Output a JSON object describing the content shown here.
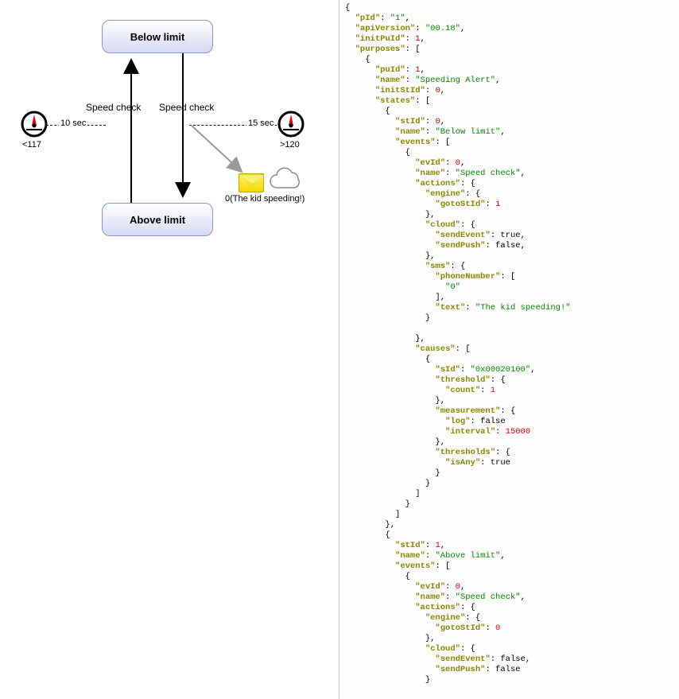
{
  "diagram": {
    "state_top": "Below limit",
    "state_bottom": "Above limit",
    "gauge_left_label": "<117",
    "gauge_right_label": ">120",
    "dash_left_label": "10 sec",
    "dash_right_label": "15 sec",
    "trans_left": "Speed check",
    "trans_right": "Speed check",
    "msg_caption": "0(The kid speeding!)"
  },
  "json_text": "{\n  \"pId\": \"1\",\n  \"apiVersion\": \"00.18\",\n  \"initPuId\": 1,\n  \"purposes\": [\n    {\n      \"puId\": 1,\n      \"name\": \"Speeding Alert\",\n      \"initStId\": 0,\n      \"states\": [\n        {\n          \"stId\": 0,\n          \"name\": \"Below limit\",\n          \"events\": [\n            {\n              \"evId\": 0,\n              \"name\": \"Speed check\",\n              \"actions\": {\n                \"engine\": {\n                  \"gotoStId\": 1\n                },\n                \"cloud\": {\n                  \"sendEvent\": true,\n                  \"sendPush\": false,\n                },\n                \"sms\": {\n                  \"phoneNumber\": [\n                    \"0\"\n                  ],\n                  \"text\": \"The kid speeding!\"\n                }\n\n              },\n              \"causes\": [\n                {\n                  \"sId\": \"0x00020100\",\n                  \"threshold\": {\n                    \"count\": 1\n                  },\n                  \"measurement\": {\n                    \"log\": false\n                    \"interval\": 15000\n                  },\n                  \"thresholds\": {\n                    \"isAny\": true\n                  }\n                }\n              ]\n            }\n          ]\n        },\n        {\n          \"stId\": 1,\n          \"name\": \"Above limit\",\n          \"events\": [\n            {\n              \"evId\": 0,\n              \"name\": \"Speed check\",\n              \"actions\": {\n                \"engine\": {\n                  \"gotoStId\": 0\n                },\n                \"cloud\": {\n                  \"sendEvent\": false,\n                  \"sendPush\": false\n                }"
}
